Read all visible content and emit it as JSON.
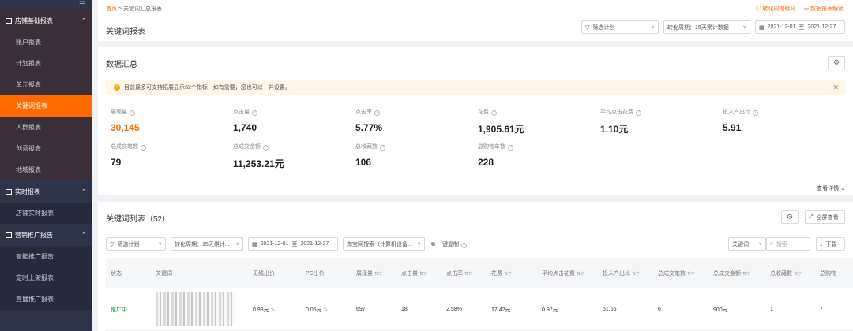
{
  "sidebar": {
    "groups": [
      {
        "label": "店铺基础报表",
        "items": [
          "账户报表",
          "计划报表",
          "单元报表",
          "关键词报表",
          "人群报表",
          "创意报表",
          "地域报表"
        ]
      },
      {
        "label": "实时报表",
        "items": [
          "店铺实时报表"
        ]
      },
      {
        "label": "营销推广报告",
        "items": [
          "智能推广报告",
          "定时上架报表",
          "直播推广报表"
        ]
      }
    ],
    "active": "关键词报表"
  },
  "header": {
    "breadcrumb_home": "首页",
    "breadcrumb_sep": ">",
    "breadcrumb_current": "关键词汇总报表",
    "link1": "转化周期释义",
    "link2": "数据报表解读",
    "title": "关键词报表",
    "filter_plan": "筛选计划",
    "period": "转化周期：15天累计数据",
    "date_start": "2021-12-01",
    "date_sep": "至",
    "date_end": "2021-12-27"
  },
  "summary": {
    "title": "数据汇总",
    "notice": "目前最多可支持拓展显示32个指标，如有需要，您也可以一并设置。",
    "metrics": [
      {
        "label": "展现量",
        "value": "30,145",
        "highlight": true
      },
      {
        "label": "点击量",
        "value": "1,740"
      },
      {
        "label": "点击率",
        "value": "5.77%"
      },
      {
        "label": "花费",
        "value": "1,905.61元"
      },
      {
        "label": "平均点击花费",
        "value": "1.10元"
      },
      {
        "label": "投入产出比",
        "value": "5.91"
      },
      {
        "label": "总成交笔数",
        "value": "79"
      },
      {
        "label": "总成交金额",
        "value": "11,253.21元"
      },
      {
        "label": "总收藏数",
        "value": "106"
      },
      {
        "label": "总购物车数",
        "value": "228"
      }
    ],
    "more": "查看详情"
  },
  "keywords": {
    "title": "关键词列表（52）",
    "fullscreen": "全屏查看",
    "filter_plan": "筛选计划",
    "period": "转化周期：15天累计...",
    "date_start": "2021-12-01",
    "date_sep": "至",
    "date_end": "2021-12-27",
    "search_type": "淘宝网搜索（计算机设备...",
    "copy": "一键复制",
    "kw_select": "关键词",
    "search_placeholder": "搜索",
    "download": "下载",
    "columns": [
      "状态",
      "关键词",
      "无线出价",
      "PC出价",
      "展现量",
      "点击量",
      "点击率",
      "花费",
      "平均点击花费",
      "投入产出比",
      "总成交笔数",
      "总成交金额",
      "总收藏数",
      "总购物"
    ],
    "rows": [
      [
        "推广中",
        "",
        "0.98元",
        "0.05元",
        "697",
        "18",
        "2.58%",
        "17.42元",
        "0.97元",
        "51.66",
        "6",
        "900元",
        "1",
        "7"
      ]
    ]
  }
}
